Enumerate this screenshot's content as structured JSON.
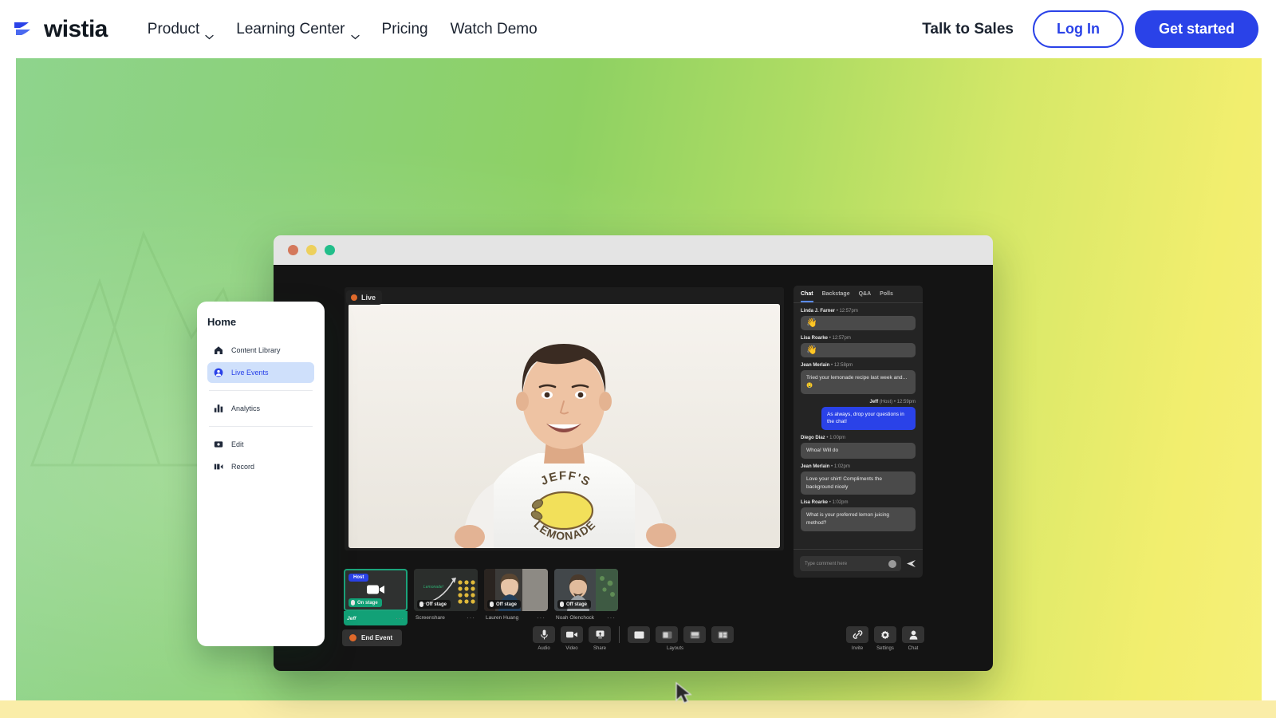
{
  "nav": {
    "logo_text": "wistia",
    "items": [
      {
        "label": "Product",
        "has_chevron": true
      },
      {
        "label": "Learning Center",
        "has_chevron": true
      },
      {
        "label": "Pricing",
        "has_chevron": false
      },
      {
        "label": "Watch Demo",
        "has_chevron": false
      }
    ],
    "talk_to_sales": "Talk to Sales",
    "login": "Log In",
    "get_started": "Get started"
  },
  "colors": {
    "brand_blue": "#2A42E8",
    "accent_yellow": "#FAEDA8",
    "hero_green": "#8ED163",
    "hero_yellow": "#F6F07A",
    "live_orange": "#E06A2B",
    "on_stage_green": "#12A177"
  },
  "sidecard": {
    "title": "Home",
    "items": [
      {
        "label": "Content Library",
        "icon": "home-icon",
        "active": false
      },
      {
        "label": "Live Events",
        "icon": "live-events-icon",
        "active": true
      },
      {
        "label": "Analytics",
        "icon": "analytics-icon",
        "active": false
      },
      {
        "label": "Edit",
        "icon": "edit-icon",
        "active": false
      },
      {
        "label": "Record",
        "icon": "record-icon",
        "active": false
      }
    ]
  },
  "app": {
    "window_dots": [
      "close",
      "minimize",
      "maximize"
    ],
    "stage": {
      "live_label": "Live",
      "shirt_text_top": "JEFF'S",
      "shirt_text_bottom": "LEMONADE"
    },
    "thumbnails": [
      {
        "name": "Jeff",
        "status": "On stage",
        "badge": "Host",
        "selected": true
      },
      {
        "name": "Screenshare",
        "status": "Off stage",
        "badge": "",
        "selected": false
      },
      {
        "name": "Lauren Huang",
        "status": "Off stage",
        "badge": "",
        "selected": false
      },
      {
        "name": "Noah Olenchock",
        "status": "Off stage",
        "badge": "",
        "selected": false
      }
    ],
    "chat": {
      "tabs": [
        {
          "label": "Chat",
          "active": true
        },
        {
          "label": "Backstage",
          "active": false
        },
        {
          "label": "Q&A",
          "active": false
        },
        {
          "label": "Polls",
          "active": false
        }
      ],
      "messages": [
        {
          "author": "Linda J. Farner",
          "time": "12:57pm",
          "text": "👋",
          "emoji": true,
          "mine": false
        },
        {
          "author": "Lisa Roarke",
          "time": "12:57pm",
          "text": "👋",
          "emoji": true,
          "mine": false
        },
        {
          "author": "Jean Merlain",
          "time": "12:58pm",
          "text": "Tried your lemonade recipe last week and… 🤤",
          "emoji": false,
          "mine": false
        },
        {
          "author": "Jeff",
          "role": "(Host)",
          "time": "12:59pm",
          "text": "As always, drop your questions in the chat!",
          "emoji": false,
          "mine": true
        },
        {
          "author": "Diego Diaz",
          "time": "1:00pm",
          "text": "Whoa! Will do",
          "emoji": false,
          "mine": false
        },
        {
          "author": "Jean Merlain",
          "time": "1:02pm",
          "text": "Love your shirt! Compliments the background nicely",
          "emoji": false,
          "mine": false
        },
        {
          "author": "Lisa Roarke",
          "time": "1:02pm",
          "text": "What is your preferred lemon juicing method?",
          "emoji": false,
          "mine": false
        }
      ],
      "input_placeholder": "Type comment here"
    },
    "controls": {
      "end_event": "End Event",
      "center": [
        {
          "label": "Audio",
          "icon": "microphone-icon"
        },
        {
          "label": "Video",
          "icon": "camera-icon"
        },
        {
          "label": "Share",
          "icon": "screen-share-icon"
        }
      ],
      "layouts_label": "Layouts",
      "layout_buttons": [
        {
          "icon": "layout-single-icon"
        },
        {
          "icon": "layout-sidebar-icon"
        },
        {
          "icon": "layout-stacked-icon"
        },
        {
          "icon": "layout-grid-icon"
        }
      ],
      "right": [
        {
          "label": "Invite",
          "icon": "link-icon"
        },
        {
          "label": "Settings",
          "icon": "gear-icon"
        },
        {
          "label": "Chat",
          "icon": "person-icon"
        }
      ]
    }
  }
}
